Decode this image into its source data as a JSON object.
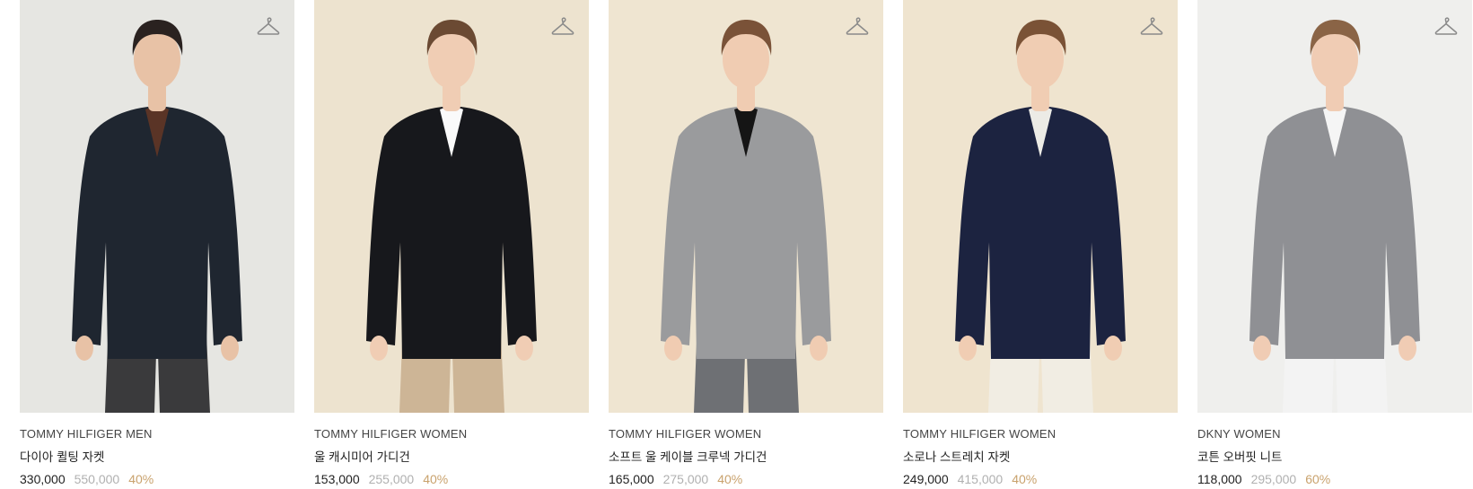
{
  "products": [
    {
      "brand": "TOMMY HILFIGER MEN",
      "name": "다이아 퀼팅 자켓",
      "price": "330,000",
      "original_price": "550,000",
      "discount": "40%",
      "bg": "#e6e6e2",
      "garment": "#1f2630",
      "accent": "#5a3426",
      "skin": "#e8c2a6",
      "hair": "#2a2220",
      "lower": "#3a3a3c"
    },
    {
      "brand": "TOMMY HILFIGER WOMEN",
      "name": "울 캐시미어 가디건",
      "price": "153,000",
      "original_price": "255,000",
      "discount": "40%",
      "bg": "#ede3cf",
      "garment": "#17181c",
      "accent": "#fafafa",
      "skin": "#f0cdb4",
      "hair": "#6b4a33",
      "lower": "#cdb596"
    },
    {
      "brand": "TOMMY HILFIGER WOMEN",
      "name": "소프트 울 케이블 크루넥 가디건",
      "price": "165,000",
      "original_price": "275,000",
      "discount": "40%",
      "bg": "#efe5d1",
      "garment": "#9a9b9d",
      "accent": "#151515",
      "skin": "#f0ccb2",
      "hair": "#7a5238",
      "lower": "#6e7074"
    },
    {
      "brand": "TOMMY HILFIGER WOMEN",
      "name": "소로나 스트레치 자켓",
      "price": "249,000",
      "original_price": "415,000",
      "discount": "40%",
      "bg": "#efe4cf",
      "garment": "#1c2340",
      "accent": "#ecebe6",
      "skin": "#f0cdb3",
      "hair": "#7a5236",
      "lower": "#f1ede3"
    },
    {
      "brand": "DKNY WOMEN",
      "name": "코튼 오버핏 니트",
      "price": "118,000",
      "original_price": "295,000",
      "discount": "60%",
      "bg": "#efefed",
      "garment": "#8f9094",
      "accent": "#f5f5f5",
      "skin": "#f0ccb4",
      "hair": "#8a6446",
      "lower": "#f3f3f3"
    }
  ],
  "icons": {
    "wishlist": "hanger-icon"
  }
}
